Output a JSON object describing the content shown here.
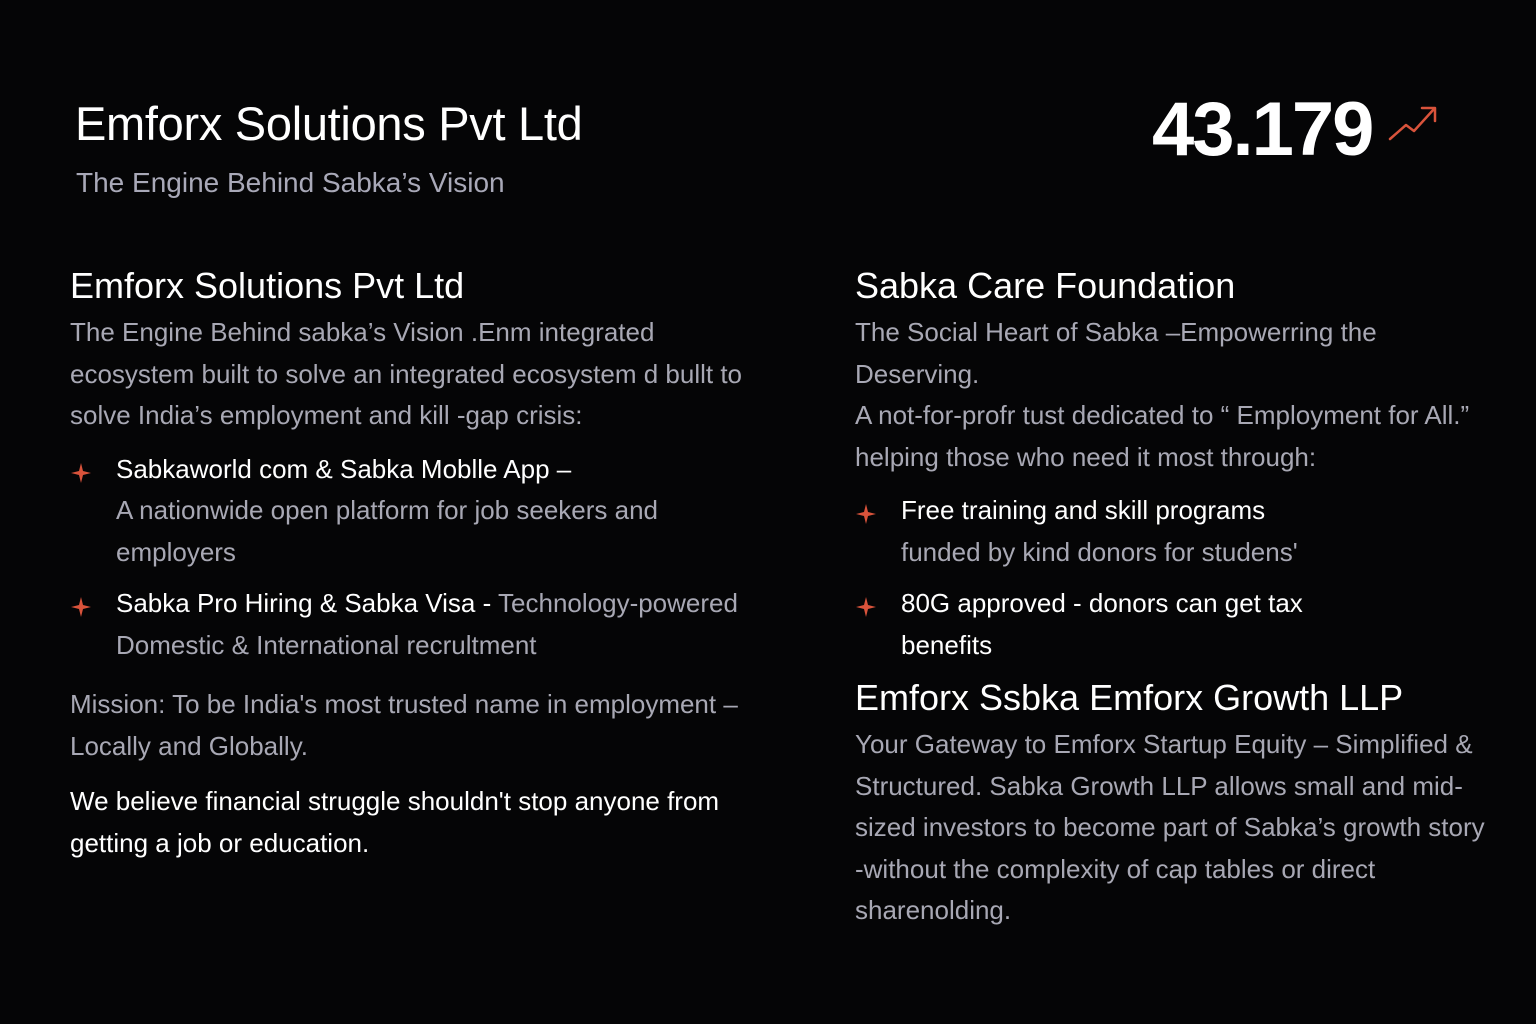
{
  "hero": {
    "title": "Emforx Solutions Pvt Ltd",
    "subtitle": "The Engine Behind Sabka’s Vision"
  },
  "metric": {
    "value": "43.179",
    "icon": "trend-up-icon",
    "icon_color": "#d9533b"
  },
  "left": {
    "title": "Emforx Solutions Pvt Ltd",
    "intro": "The Engine Behind sabka’s Vision .Enm integrated ecosystem built to solve an integrated ecosystem d bullt to solve India’s employment and kill -gap crisis:",
    "bullets": [
      {
        "head": "Sabkaworld com & Sabka Moblle App –",
        "desc": "A nationwide open platform for job seekers and employers"
      },
      {
        "head": "Sabka Pro Hiring & Sabka Visa -",
        "desc": "Technology-powered Domestic & International recrultment"
      }
    ],
    "mission": "Mission: To be India's most trusted name in employment – Locally and Globally.",
    "belief": "We believe financial struggle shouldn't stop anyone from getting a job or education."
  },
  "right": {
    "title": "Sabka Care Foundation",
    "tagline": "The Social Heart of Sabka –Empowerring the Deserving.",
    "intro": "A not-for-profr tust dedicated to “ Employment for All.” helping those who need it most through:",
    "bullets": [
      {
        "head": "Free training and skill programs",
        "desc": "funded by kind donors for studens'"
      },
      {
        "head": "80G approved - donors can get tax benefits",
        "desc": ""
      }
    ],
    "title2": "Emforx Ssbka Emforx Growth LLP",
    "description2": "Your Gateway to Emforx Startup Equity – Simplified & Structured. Sabka Growth LLP allows small and mid-sized investors to become part of Sabka’s growth story -without the complexity of cap tables or direct sharenolding."
  },
  "colors": {
    "background": "#050506",
    "accent": "#d9533b",
    "muted_text": "#a8a8b4"
  }
}
